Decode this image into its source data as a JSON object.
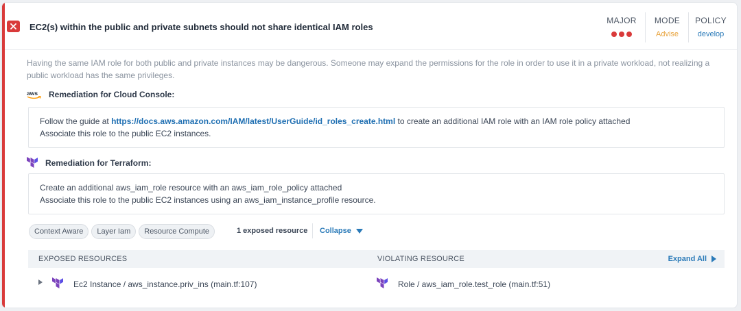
{
  "finding": {
    "title": "EC2(s) within the public and private subnets should not share identical IAM roles",
    "description": "Having the same IAM role for both public and private instances may be dangerous. Someone may expand the permissions for the role in order to use it in a private workload, not realizing a public workload has the same privileges.",
    "status_icon": "close-icon"
  },
  "meta": {
    "severity_label": "MAJOR",
    "severity_dots": 3,
    "mode_label": "MODE",
    "mode_value": "Advise",
    "policy_label": "POLICY",
    "policy_value": "develop"
  },
  "remediation_console": {
    "icon": "aws-logo-icon",
    "title": "Remediation for Cloud Console:",
    "prefix": "Follow the guide at ",
    "link": "https://docs.aws.amazon.com/IAM/latest/UserGuide/id_roles_create.html",
    "suffix": " to create an additional IAM role with an IAM role policy attached",
    "line2": "Associate this role to the public EC2 instances."
  },
  "remediation_terraform": {
    "icon": "terraform-logo-icon",
    "title": "Remediation for Terraform:",
    "line1": "Create an additional aws_iam_role resource with an aws_iam_role_policy attached",
    "line2": "Associate this role to the public EC2 instances using an aws_iam_instance_profile resource."
  },
  "tags": [
    "Context Aware",
    "Layer Iam",
    "Resource Compute"
  ],
  "exposed_count": "1 exposed resource",
  "collapse_label": "Collapse",
  "resources": {
    "col_exposed": "EXPOSED RESOURCES",
    "col_violating": "VIOLATING RESOURCE",
    "expand_all": "Expand All",
    "rows": [
      {
        "exposed": "Ec2 Instance / aws_instance.priv_ins (main.tf:107)",
        "violating": "Role / aws_iam_role.test_role (main.tf:51)"
      }
    ]
  },
  "colors": {
    "severity": "#d93a3a",
    "mode": "#e8a33c",
    "link": "#1f6fb2",
    "terraform": "#7b42bc",
    "aws_orange": "#ff9900"
  }
}
